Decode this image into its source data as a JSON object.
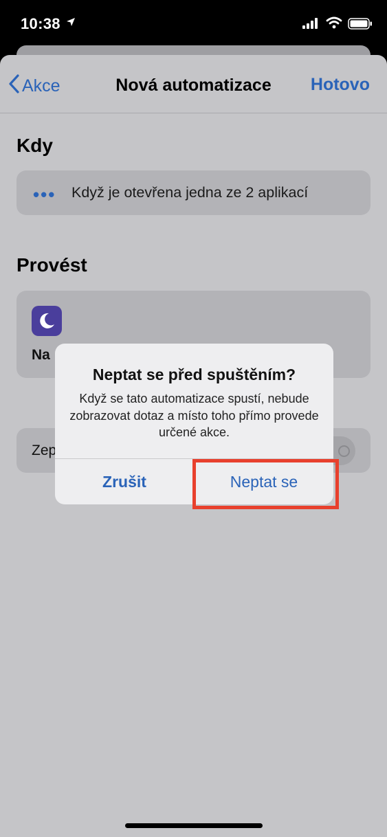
{
  "status_bar": {
    "time": "10:38"
  },
  "nav": {
    "back_label": "Akce",
    "title": "Nová automatizace",
    "done_label": "Hotovo"
  },
  "when": {
    "heading": "Kdy",
    "trigger_text": "Když je otevřena jedna ze 2 aplikací"
  },
  "do": {
    "heading": "Provést",
    "action_label_partial": "Na"
  },
  "ask_toggle": {
    "label_partial": "Zep"
  },
  "alert": {
    "title": "Neptat se před spuštěním?",
    "message": "Když se tato automatizace spustí, nebude zobrazovat dotaz a místo toho přímo provede určené akce.",
    "cancel_label": "Zrušit",
    "confirm_label": "Neptat se"
  },
  "colors": {
    "accent": "#2a63b8",
    "highlight": "#e8402d",
    "app_icon": "#4a3e9c"
  },
  "icons": [
    "location-arrow-icon",
    "cellular-signal-icon",
    "wifi-icon",
    "battery-icon",
    "chevron-left-icon",
    "moon-icon",
    "more-dots-icon"
  ]
}
